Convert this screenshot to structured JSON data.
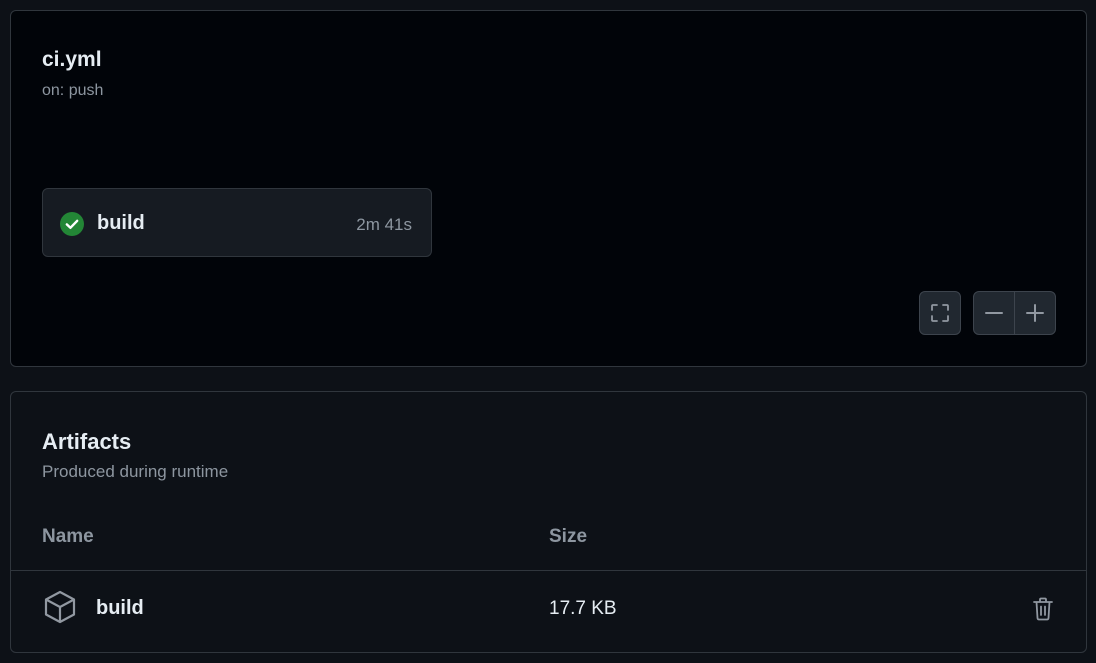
{
  "workflow": {
    "file_name": "ci.yml",
    "trigger": "on: push",
    "job": {
      "name": "build",
      "duration": "2m 41s",
      "status": "success",
      "status_icon": "check-circle-icon",
      "status_color": "#238636"
    },
    "controls": {
      "fullscreen_icon": "fullscreen-icon",
      "zoom_out_icon": "minus-icon",
      "zoom_in_icon": "plus-icon"
    }
  },
  "artifacts": {
    "title": "Artifacts",
    "subtitle": "Produced during runtime",
    "columns": {
      "name": "Name",
      "size": "Size"
    },
    "items": [
      {
        "name": "build",
        "size": "17.7 KB",
        "icon": "package-icon",
        "action_icon": "trash-icon"
      }
    ]
  },
  "colors": {
    "background": "#0d1117",
    "graph_background": "#010409",
    "border": "#30363d",
    "text_primary": "#e6edf3",
    "text_muted": "#8d96a0"
  }
}
